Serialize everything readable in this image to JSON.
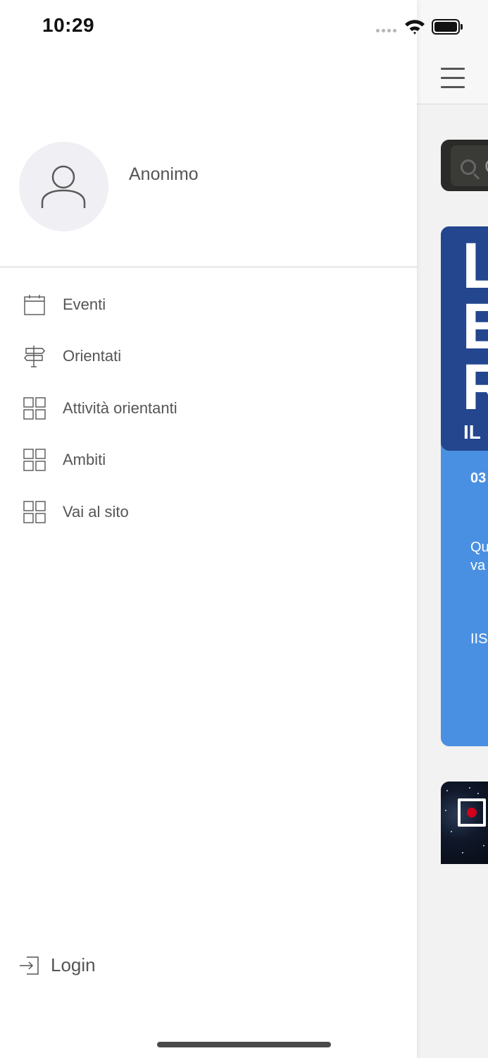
{
  "status_bar": {
    "time": "10:29"
  },
  "profile": {
    "name": "Anonimo",
    "avatar_icon": "user-outline-icon"
  },
  "menu": {
    "items": [
      {
        "label": "Eventi",
        "icon": "calendar-icon"
      },
      {
        "label": "Orientati",
        "icon": "signpost-icon"
      },
      {
        "label": "Attività orientanti",
        "icon": "grid-icon"
      },
      {
        "label": "Ambiti",
        "icon": "grid-icon"
      },
      {
        "label": "Vai al sito",
        "icon": "grid-icon"
      }
    ]
  },
  "footer": {
    "login_label": "Login",
    "login_icon": "login-icon"
  },
  "background_app": {
    "search_partial": "C",
    "banner_letters": [
      "L",
      "E",
      "R"
    ],
    "banner_sub": "IL",
    "card_date_partial": "03",
    "card_desc_partial_1": "Qu",
    "card_desc_partial_2": "va",
    "card_place_partial": "IIS"
  },
  "colors": {
    "drawer_bg": "#ffffff",
    "avatar_bg": "#efeff4",
    "card_blue": "#4a90e2",
    "banner_navy": "#23468f",
    "record_red": "#d0021b"
  }
}
